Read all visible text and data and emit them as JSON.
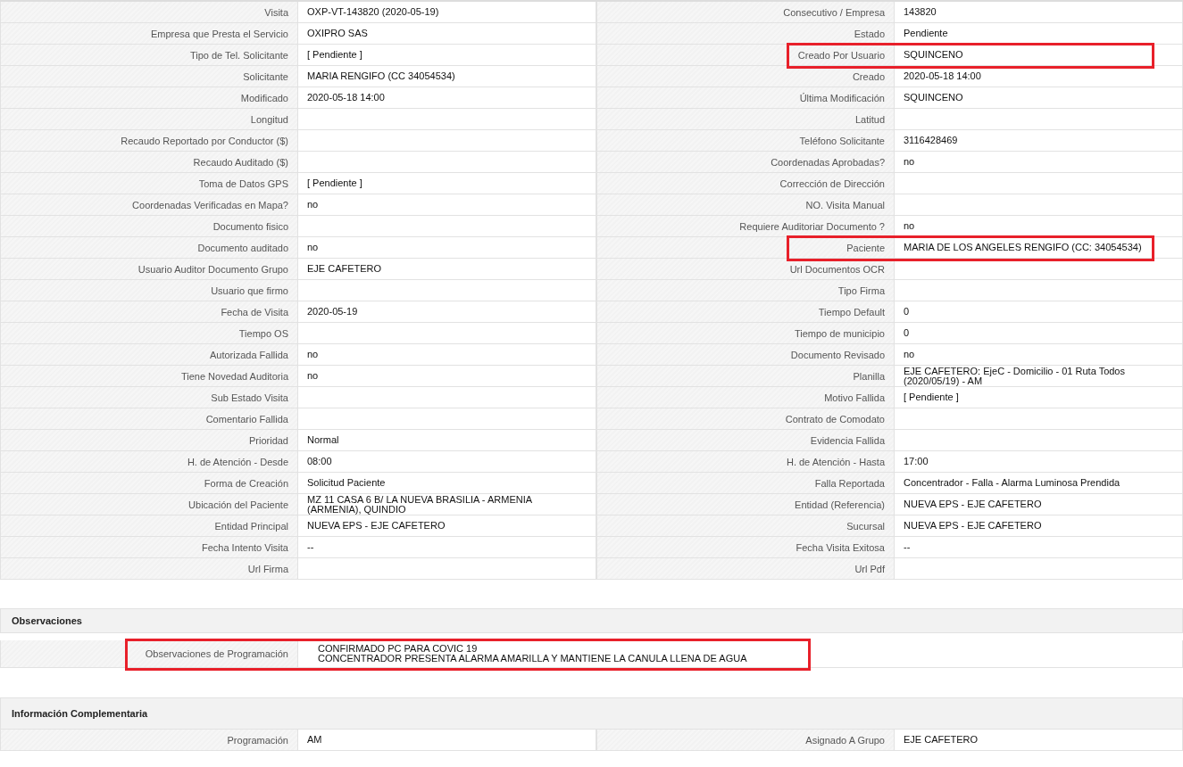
{
  "details": {
    "rows": [
      [
        {
          "label": "Visita",
          "value": "OXP-VT-143820 (2020-05-19)",
          "highlighted": false
        },
        {
          "label": "Consecutivo / Empresa",
          "value": "143820",
          "highlighted": false
        }
      ],
      [
        {
          "label": "Empresa que Presta el Servicio",
          "value": "OXIPRO SAS",
          "highlighted": false
        },
        {
          "label": "Estado",
          "value": "Pendiente",
          "highlighted": false
        }
      ],
      [
        {
          "label": "Tipo de Tel. Solicitante",
          "value": "[ Pendiente ]",
          "highlighted": false
        },
        {
          "label": "Creado Por Usuario",
          "value": "SQUINCENO",
          "highlighted": true
        }
      ],
      [
        {
          "label": "Solicitante",
          "value": "MARIA RENGIFO (CC 34054534)",
          "highlighted": false
        },
        {
          "label": "Creado",
          "value": "2020-05-18 14:00",
          "highlighted": false
        }
      ],
      [
        {
          "label": "Modificado",
          "value": "2020-05-18 14:00",
          "highlighted": false
        },
        {
          "label": "Última Modificación",
          "value": "SQUINCENO",
          "highlighted": false
        }
      ],
      [
        {
          "label": "Longitud",
          "highlighted": false
        },
        {
          "label": "Latitud",
          "highlighted": false
        }
      ],
      [
        {
          "label": "Recaudo Reportado por Conductor ($)",
          "highlighted": false
        },
        {
          "label": "Teléfono Solicitante",
          "value": "3116428469",
          "highlighted": false
        }
      ],
      [
        {
          "label": "Recaudo Auditado ($)",
          "highlighted": false
        },
        {
          "label": "Coordenadas Aprobadas?",
          "value": "no",
          "highlighted": false
        }
      ],
      [
        {
          "label": "Toma de Datos GPS",
          "value": "[ Pendiente ]",
          "highlighted": false
        },
        {
          "label": "Corrección de Dirección",
          "highlighted": false
        }
      ],
      [
        {
          "label": "Coordenadas Verificadas en Mapa?",
          "value": "no",
          "highlighted": false
        },
        {
          "label": "NO. Visita Manual",
          "highlighted": false
        }
      ],
      [
        {
          "label": "Documento fisico",
          "highlighted": false
        },
        {
          "label": "Requiere Auditoriar Documento ?",
          "value": "no",
          "highlighted": false
        }
      ],
      [
        {
          "label": "Documento auditado",
          "value": "no",
          "highlighted": false
        },
        {
          "label": "Paciente",
          "value": "MARIA DE LOS ANGELES RENGIFO (CC: 34054534)",
          "highlighted": true
        }
      ],
      [
        {
          "label": "Usuario Auditor Documento Grupo",
          "value": "EJE CAFETERO",
          "highlighted": false
        },
        {
          "label": "Url Documentos OCR",
          "highlighted": false
        }
      ],
      [
        {
          "label": "Usuario que firmo",
          "highlighted": false
        },
        {
          "label": "Tipo Firma",
          "highlighted": false
        }
      ],
      [
        {
          "label": "Fecha de Visita",
          "value": "2020-05-19",
          "highlighted": false
        },
        {
          "label": "Tiempo Default",
          "value": "0",
          "highlighted": false
        }
      ],
      [
        {
          "label": "Tiempo OS",
          "highlighted": false
        },
        {
          "label": "Tiempo de municipio",
          "value": "0",
          "highlighted": false
        }
      ],
      [
        {
          "label": "Autorizada Fallida",
          "value": "no",
          "highlighted": false
        },
        {
          "label": "Documento Revisado",
          "value": "no",
          "highlighted": false
        }
      ],
      [
        {
          "label": "Tiene Novedad Auditoria",
          "value": "no",
          "highlighted": false
        },
        {
          "label": "Planilla",
          "value": "EJE CAFETERO: EjeC - Domicilio - 01 Ruta Todos (2020/05/19) - AM",
          "highlighted": false
        }
      ],
      [
        {
          "label": "Sub Estado Visita",
          "highlighted": false
        },
        {
          "label": "Motivo Fallida",
          "value": "[ Pendiente ]",
          "highlighted": false
        }
      ],
      [
        {
          "label": "Comentario Fallida",
          "highlighted": false
        },
        {
          "label": "Contrato de Comodato",
          "highlighted": false
        }
      ],
      [
        {
          "label": "Prioridad",
          "value": "Normal",
          "highlighted": false
        },
        {
          "label": "Evidencia Fallida",
          "highlighted": false
        }
      ],
      [
        {
          "label": "H. de Atención - Desde",
          "value": "08:00",
          "highlighted": false
        },
        {
          "label": "H. de Atención - Hasta",
          "value": "17:00",
          "highlighted": false
        }
      ],
      [
        {
          "label": "Forma de Creación",
          "value": "Solicitud Paciente",
          "highlighted": false
        },
        {
          "label": "Falla Reportada",
          "value": "Concentrador - Falla - Alarma Luminosa Prendida",
          "highlighted": false
        }
      ],
      [
        {
          "label": "Ubicación del Paciente",
          "value": "MZ 11 CASA 6 B/ LA NUEVA BRASILIA - ARMENIA (ARMENIA), QUINDIO",
          "highlighted": false
        },
        {
          "label": "Entidad (Referencia)",
          "value": "NUEVA EPS - EJE CAFETERO",
          "highlighted": false
        }
      ],
      [
        {
          "label": "Entidad Principal",
          "value": "NUEVA EPS - EJE CAFETERO",
          "highlighted": false
        },
        {
          "label": "Sucursal",
          "value": "NUEVA EPS - EJE CAFETERO",
          "highlighted": false
        }
      ],
      [
        {
          "label": "Fecha Intento Visita",
          "value": "--",
          "highlighted": false
        },
        {
          "label": "Fecha Visita Exitosa",
          "value": "--",
          "highlighted": false
        }
      ],
      [
        {
          "label": "Url Firma",
          "highlighted": false
        },
        {
          "label": "Url Pdf",
          "highlighted": false
        }
      ]
    ]
  },
  "observaciones": {
    "title": "Observaciones",
    "label": "Observaciones de Programación",
    "lines": [
      "CONFIRMADO PC PARA COVIC 19",
      "CONCENTRADOR PRESENTA ALARMA AMARILLA Y MANTIENE LA CANULA LLENA DE AGUA"
    ],
    "highlighted": true
  },
  "complementaria": {
    "title": "Información Complementaria",
    "rows": [
      [
        {
          "label": "Programación",
          "value": "AM",
          "highlighted": false
        },
        {
          "label": "Asignado A Grupo",
          "value": "EJE CAFETERO",
          "highlighted": false
        }
      ]
    ]
  }
}
